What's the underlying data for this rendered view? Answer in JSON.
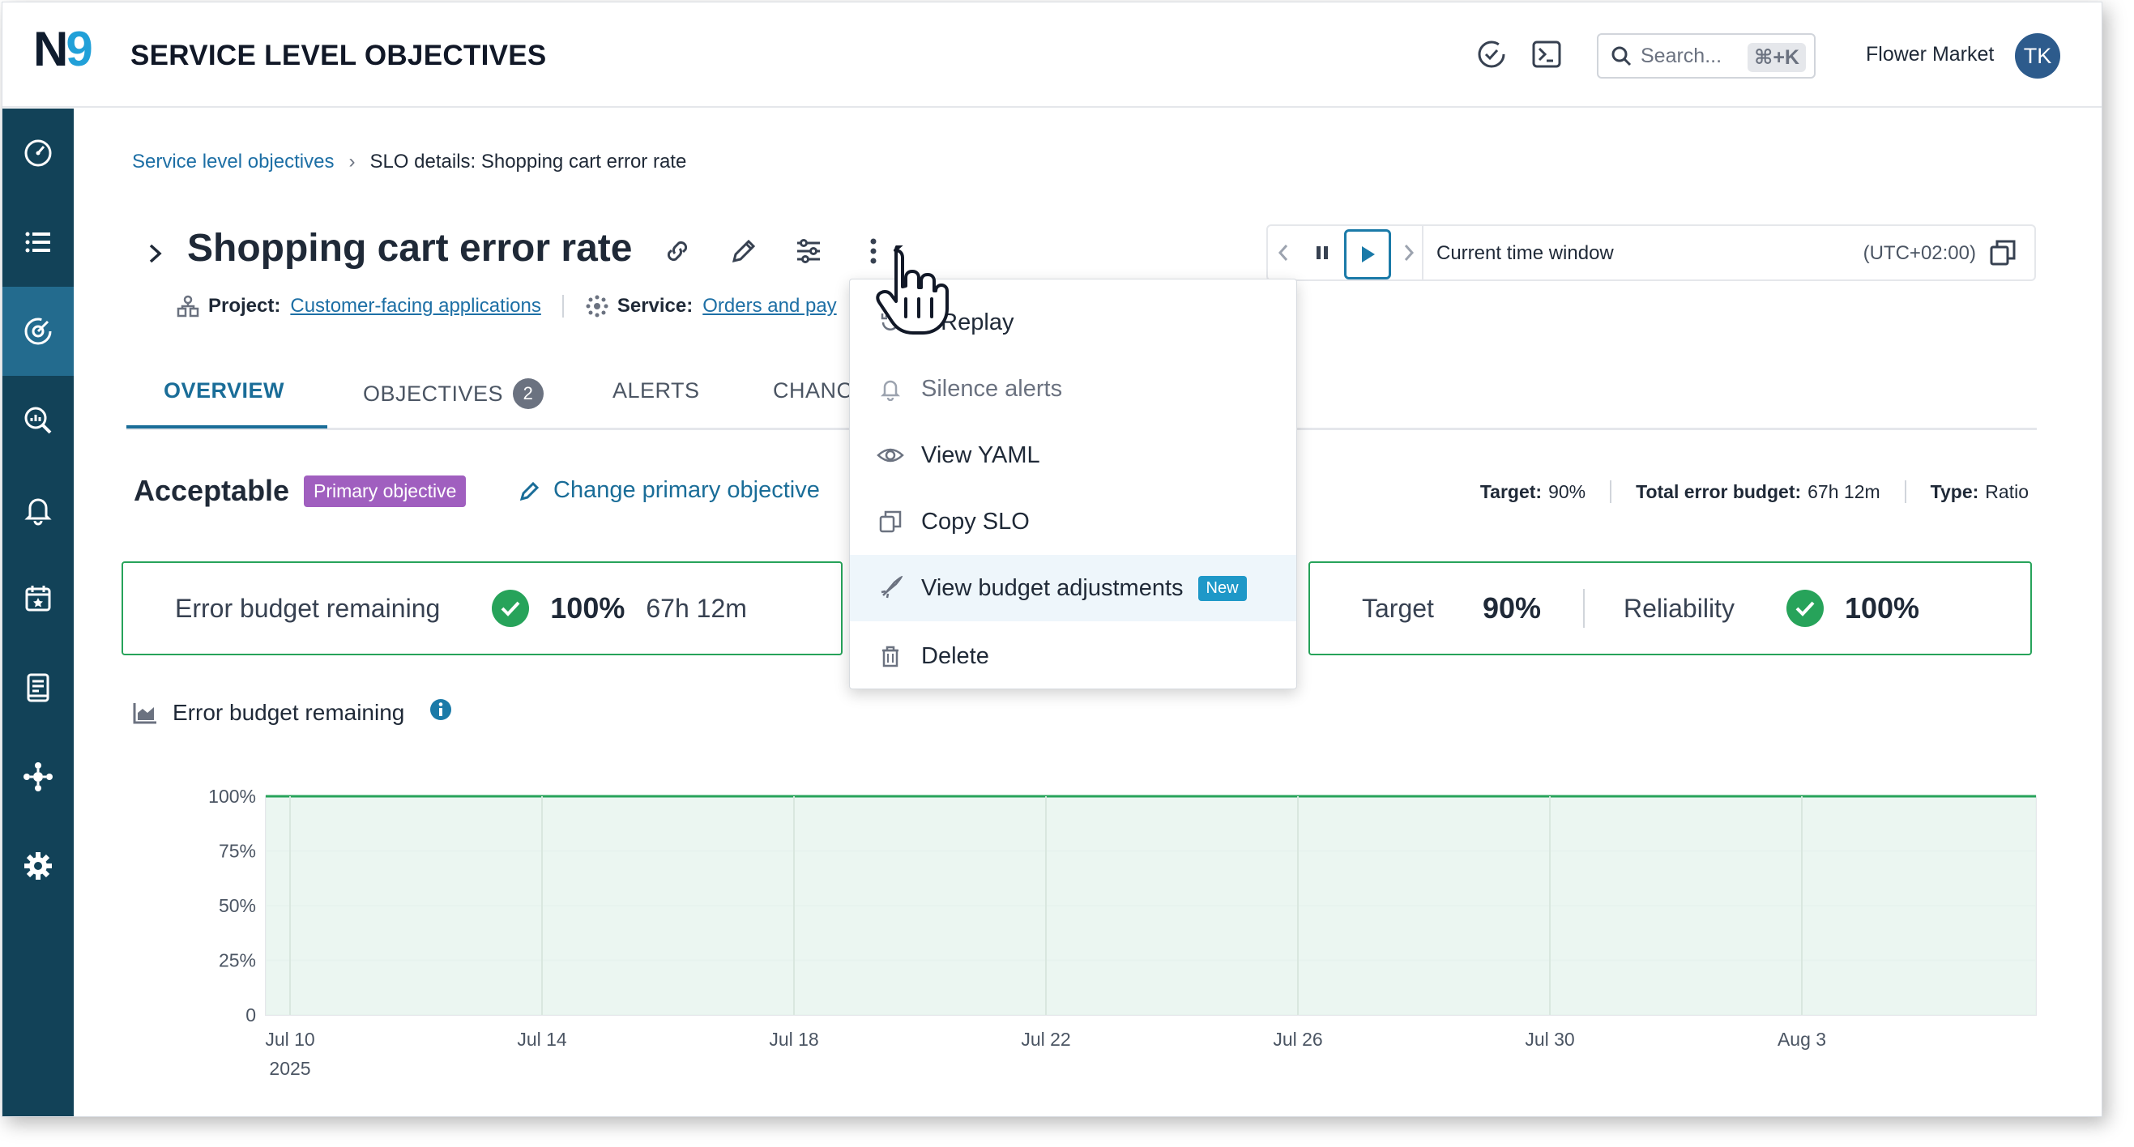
{
  "header": {
    "logo_n": "N",
    "logo_9": "9",
    "title": "SERVICE LEVEL OBJECTIVES",
    "search_placeholder": "Search...",
    "search_shortcut": "⌘+K",
    "org_name": "Flower Market",
    "avatar_initials": "TK",
    "icons": [
      "check-clock-icon",
      "terminal-icon",
      "search-icon"
    ]
  },
  "sidebar": {
    "items": [
      {
        "name": "dashboard",
        "icon": "speedometer-icon"
      },
      {
        "name": "list",
        "icon": "list-icon"
      },
      {
        "name": "slo",
        "icon": "slo-icon",
        "active": true
      },
      {
        "name": "query",
        "icon": "magnifier-chart-icon"
      },
      {
        "name": "alerts",
        "icon": "bell-icon"
      },
      {
        "name": "calendar",
        "icon": "calendar-icon"
      },
      {
        "name": "reports",
        "icon": "report-icon"
      },
      {
        "name": "integrations",
        "icon": "nodes-icon"
      },
      {
        "name": "settings",
        "icon": "gear-icon"
      }
    ]
  },
  "breadcrumb": {
    "parent": "Service level objectives",
    "separator": "›",
    "current": "SLO details: Shopping cart error rate"
  },
  "slo": {
    "title": "Shopping cart error rate",
    "project_label": "Project:",
    "project_value": "Customer-facing applications",
    "service_label": "Service:",
    "service_value": "Orders and pay"
  },
  "time_window": {
    "label": "Current time window",
    "timezone": "(UTC+02:00)"
  },
  "tabs": [
    {
      "label": "OVERVIEW",
      "active": true
    },
    {
      "label": "OBJECTIVES",
      "badge": "2"
    },
    {
      "label": "ALERTS"
    },
    {
      "label": "CHANC"
    }
  ],
  "objective": {
    "name": "Acceptable",
    "primary_badge": "Primary objective",
    "change_primary": "Change primary objective",
    "target_label": "Target:",
    "target_value": "90%",
    "total_budget_label": "Total error budget:",
    "total_budget_value": "67h 12m",
    "type_label": "Type:",
    "type_value": "Ratio"
  },
  "cards": {
    "budget_label": "Error budget remaining",
    "budget_pct": "100%",
    "budget_time": "67h 12m",
    "target_label": "Target",
    "target_value": "90%",
    "reliability_label": "Reliability",
    "reliability_value": "100%"
  },
  "chart_section": {
    "title": "Error budget remaining"
  },
  "menu": {
    "items": [
      {
        "label": "n Replay",
        "icon": "replay-icon"
      },
      {
        "label": "Silence alerts",
        "icon": "bell-icon",
        "disabled": true
      },
      {
        "label": "View YAML",
        "icon": "eye-icon"
      },
      {
        "label": "Copy SLO",
        "icon": "copy-icon"
      },
      {
        "label": "View budget adjustments",
        "icon": "rocket-icon",
        "badge": "New",
        "highlighted": true
      },
      {
        "label": "Delete",
        "icon": "trash-icon"
      }
    ]
  },
  "colors": {
    "sidebar": "#124258",
    "sidebar_active": "#236b8e",
    "accent": "#1a6d98",
    "success": "#27a35a",
    "primary_badge": "#a05fbf",
    "new_badge": "#1e98c8",
    "chart_fill": "#e8f5ee",
    "chart_line": "#27a35a"
  },
  "chart_data": {
    "type": "area",
    "title": "Error budget remaining",
    "x": [
      "Jul 10",
      "Jul 14",
      "Jul 18",
      "Jul 22",
      "Jul 26",
      "Jul 30",
      "Aug 3"
    ],
    "x_sublabel": "2025",
    "y_ticks": [
      "100%",
      "75%",
      "50%",
      "25%",
      "0"
    ],
    "ylim": [
      0,
      100
    ],
    "series": [
      {
        "values": [
          100,
          100,
          100,
          100,
          100,
          100,
          100
        ]
      }
    ],
    "grid": true
  }
}
